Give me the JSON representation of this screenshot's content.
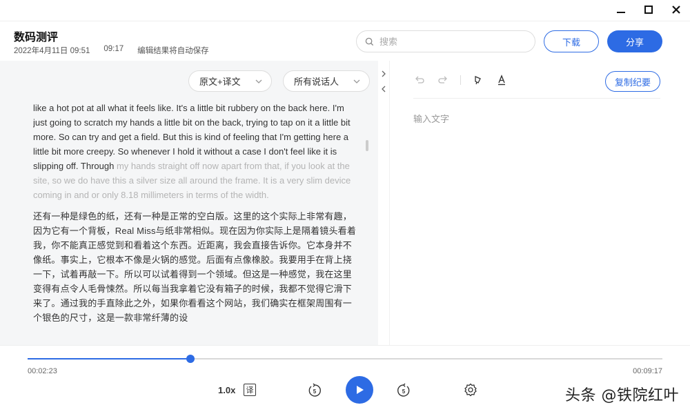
{
  "header": {
    "title": "数码测评",
    "date": "2022年4月11日 09:51",
    "duration": "09:17",
    "autosave": "编辑结果将自动保存",
    "search_placeholder": "搜索",
    "download_label": "下载",
    "share_label": "分享"
  },
  "filters": {
    "view_mode": "原文+译文",
    "speakers": "所有说话人"
  },
  "transcript": {
    "en_read": "like a hot pot at all what it feels like. It's a little bit rubbery on the back here. I'm just going to scratch my hands a little bit on the back, trying to tap on it a little bit more. So can try and get a field. But this is kind of feeling that I'm getting here a little bit more creepy. So whenever I hold it without a case I don't feel like it is slipping off. Through",
    "en_unread": " my hands straight off now apart from that, if you look at the site, so we do have this a silver size all around the frame. It is a very slim device coming in and or only 8.18 millimeters in terms of the width.",
    "zh": "还有一种是绿色的纸，还有一种是正常的空白版。这里的这个实际上非常有趣，因为它有一个背板，Real Miss与纸非常相似。现在因为你实际上是隔着镜头看着我，你不能真正感觉到和看着这个东西。近距离，我会直接告诉你。它本身并不像纸。事实上，它根本不像是火锅的感觉。后面有点像橡胶。我要用手在背上挠一下，试着再敲一下。所以可以试着得到一个领域。但这是一种感觉，我在这里变得有点令人毛骨悚然。所以每当我拿着它没有箱子的时候，我都不觉得它滑下来了。通过我的手直除此之外，如果你看看这个网站，我们确实在框架周围有一个银色的尺寸，这是一款非常纤薄的设"
  },
  "editor": {
    "copy_label": "复制纪要",
    "placeholder": "输入文字"
  },
  "player": {
    "current_time": "00:02:23",
    "total_time": "00:09:17",
    "progress_fraction": 0.2567,
    "speed": "1.0x",
    "translate_glyph": "译",
    "skip_back_seconds": "5",
    "skip_forward_seconds": "5"
  },
  "watermark": "头条 @铁院红叶",
  "colors": {
    "accent": "#2d6be4",
    "pane_bg": "#f5f6f7"
  },
  "icons": [
    "minimize-icon",
    "maximize-icon",
    "close-icon",
    "search-icon",
    "chevron-down-icon",
    "chevron-right-icon",
    "chevron-left-icon",
    "undo-icon",
    "redo-icon",
    "highlighter-icon",
    "text-color-icon",
    "rewind-5-icon",
    "play-icon",
    "forward-5-icon",
    "settings-icon"
  ]
}
